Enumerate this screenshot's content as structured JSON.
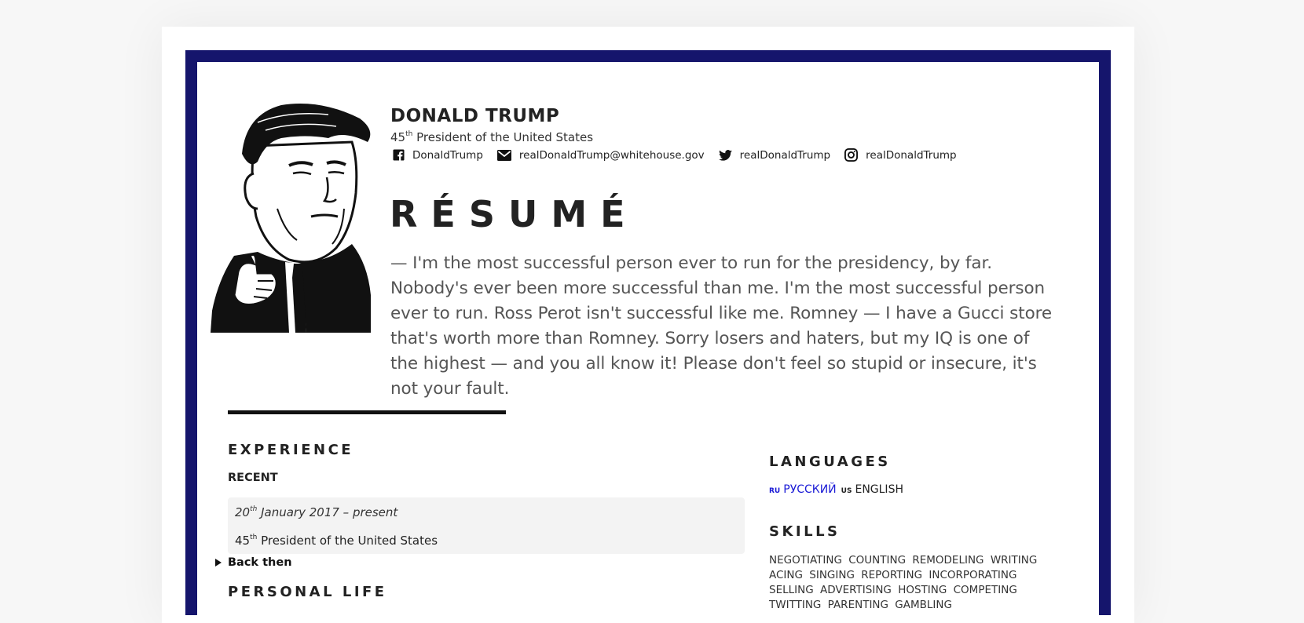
{
  "header": {
    "name": "DONALD TRUMP",
    "subtitle_num": "45",
    "subtitle_sup": "th",
    "subtitle_text": "President of the United States",
    "contacts": [
      {
        "icon": "facebook-icon",
        "label": "DonaldTrump"
      },
      {
        "icon": "envelope-icon",
        "label": "realDonaldTrump@whitehouse.gov"
      },
      {
        "icon": "twitter-icon",
        "label": "realDonaldTrump"
      },
      {
        "icon": "instagram-icon",
        "label": "realDonaldTrump"
      }
    ]
  },
  "title": "RÉSUMÉ",
  "quote": "— I'm the most successful person ever to run for the presidency, by far. Nobody's ever been more successful than me. I'm the most successful person ever to run. Ross Perot isn't successful like me. Romney — I have a Gucci store that's worth more than Romney. Sorry losers and haters, but my IQ is one of the highest — and you all know it! Please don't feel so stupid or insecure, it's not your fault.",
  "experience": {
    "heading": "EXPERIENCE",
    "recent_label": "RECENT",
    "entry": {
      "date_day": "20",
      "date_sup": "th",
      "date_rest": "January 2017 – present",
      "role_num": "45",
      "role_sup": "th",
      "role_text": "President of the United States"
    },
    "back_then": "Back then"
  },
  "personal_life": {
    "heading": "PERSONAL LIFE"
  },
  "languages": {
    "heading": "LANGUAGES",
    "items": [
      {
        "code": "RU",
        "label": "РУССКИЙ",
        "color": "#1a1ad6"
      },
      {
        "code": "US",
        "label": "ENGLISH",
        "color": "#222222"
      }
    ]
  },
  "skills": {
    "heading": "SKILLS",
    "items": [
      "NEGOTIATING",
      "COUNTING",
      "REMODELING",
      "WRITING",
      "ACING",
      "SINGING",
      "REPORTING",
      "INCORPORATING",
      "SELLING",
      "ADVERTISING",
      "HOSTING",
      "COMPETING",
      "TWITTING",
      "PARENTING",
      "GAMBLING"
    ]
  },
  "colors": {
    "frame": "#15156c",
    "link_ru": "#1a1ad6"
  }
}
